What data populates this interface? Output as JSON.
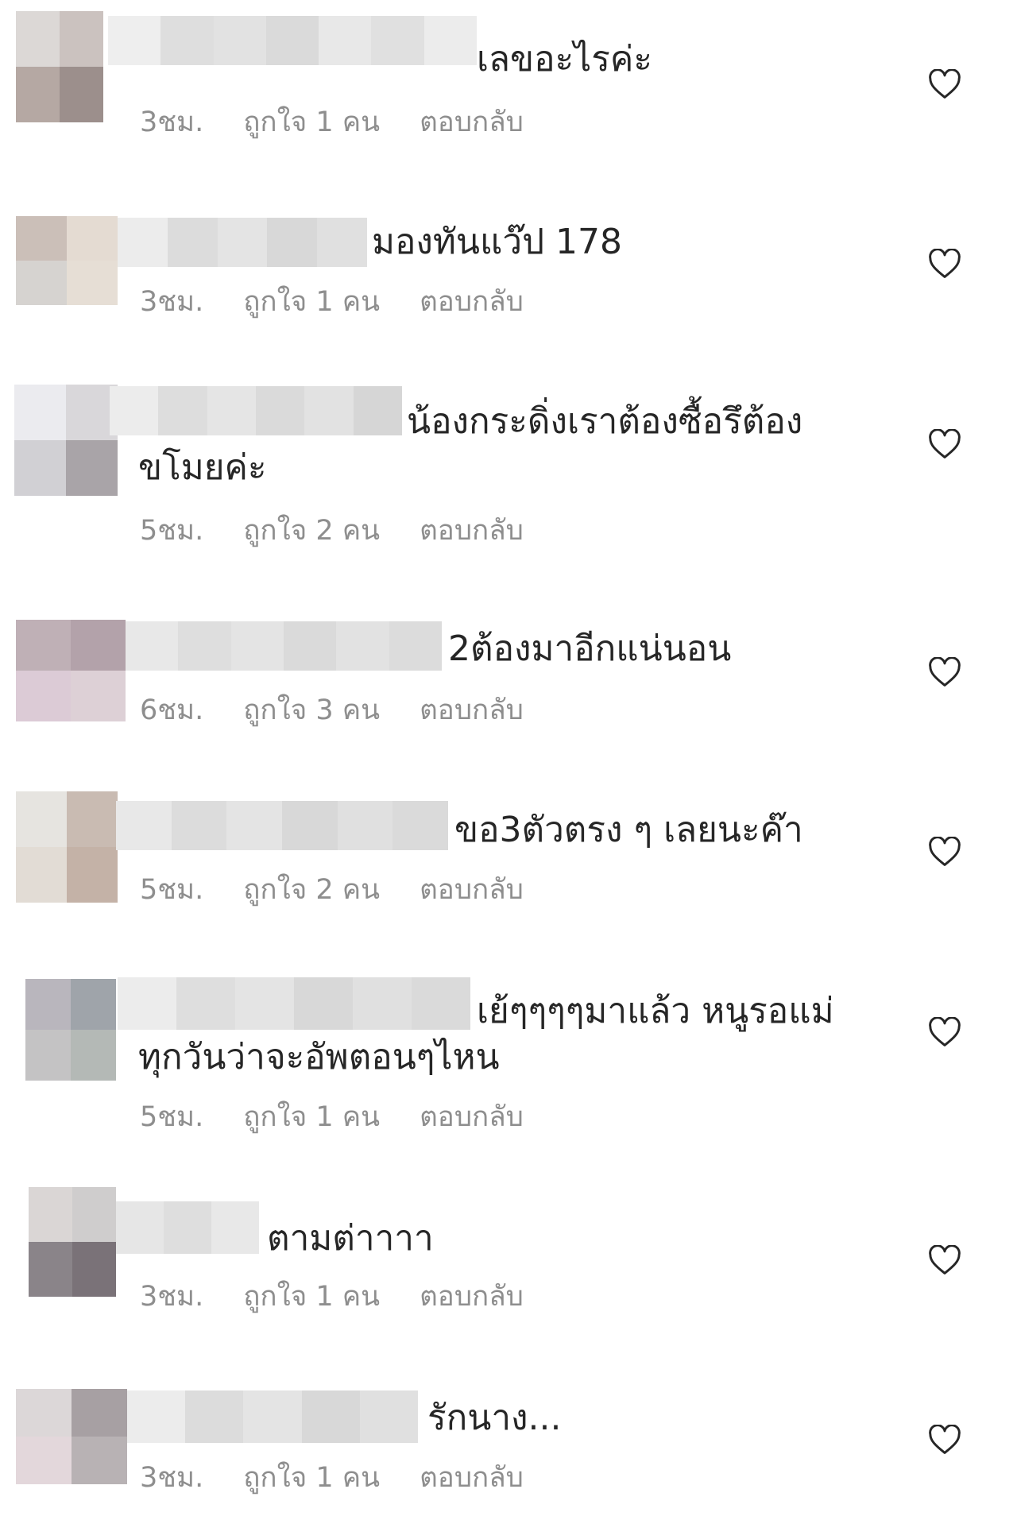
{
  "comments": [
    {
      "text_line1": "เลขอะไรค่ะ",
      "text_line2": "",
      "time": "3ชม.",
      "likes": "ถูกใจ 1 คน",
      "reply": "ตอบกลับ",
      "avatar": [
        "#dcd8d6",
        "#cbc2bf",
        "#b5a8a3",
        "#9c8f8c"
      ],
      "blur": [
        "#eeeeee",
        "#dedede",
        "#e2e2e2",
        "#dadada",
        "#e8e8e8",
        "#e0e0e0",
        "#ececec"
      ]
    },
    {
      "text_line1": "มองทันแว๊ป  178",
      "text_line2": "",
      "time": "3ชม.",
      "likes": "ถูกใจ 1 คน",
      "reply": "ตอบกลับ",
      "avatar": [
        "#cbbfb8",
        "#e4dbd2",
        "#d6d3d0",
        "#e6ded5"
      ],
      "blur": [
        "#ececec",
        "#dcdcdc",
        "#e4e4e4",
        "#d8d8d8",
        "#e0e0e0"
      ]
    },
    {
      "text_line1": "น้องกระดิ่งเราต้องซื้อรึต้อง",
      "text_line2": "ขโมยค่ะ",
      "time": "5ชม.",
      "likes": "ถูกใจ 2 คน",
      "reply": "ตอบกลับ",
      "avatar": [
        "#ebebef",
        "#d9d7da",
        "#d1d0d4",
        "#a9a4a8"
      ],
      "blur": [
        "#ececec",
        "#dddddd",
        "#e5e5e5",
        "#dadada",
        "#e2e2e2",
        "#d6d6d6"
      ]
    },
    {
      "text_line1": "2ต้องมาอีกแน่นอน",
      "text_line2": "",
      "time": "6ชม.",
      "likes": "ถูกใจ 3 คน",
      "reply": "ตอบกลับ",
      "avatar": [
        "#bfb0b6",
        "#b3a2aa",
        "#dccbd6",
        "#ddd0d6"
      ],
      "blur": [
        "#e8e8e8",
        "#dedede",
        "#e4e4e4",
        "#dadada",
        "#e2e2e2",
        "#dcdcdc"
      ]
    },
    {
      "text_line1": "ขอ3ตัวตรง ๆ เลยนะค๊า",
      "text_line2": "",
      "time": "5ชม.",
      "likes": "ถูกใจ 2 คน",
      "reply": "ตอบกลับ",
      "avatar": [
        "#e6e4e0",
        "#c9bbb2",
        "#e2dcd5",
        "#c4b2a7"
      ],
      "blur": [
        "#e8e8e8",
        "#dcdcdc",
        "#e4e4e4",
        "#d8d8d8",
        "#e0e0e0",
        "#dadada"
      ]
    },
    {
      "text_line1": "เย้ๆๆๆๆมาแล้ว หนูรอแม่",
      "text_line2": "ทุกวันว่าจะอัพตอนๆไหน",
      "time": "5ชม.",
      "likes": "ถูกใจ 1 คน",
      "reply": "ตอบกลับ",
      "avatar": [
        "#b9b6bd",
        "#9fa4aa",
        "#c4c3c4",
        "#b4b9b6"
      ],
      "blur": [
        "#ececec",
        "#dedede",
        "#e4e4e4",
        "#d8d8d8",
        "#e0e0e0",
        "#dadada"
      ]
    },
    {
      "text_line1": "ตามต่าาาา",
      "text_line2": "",
      "time": "3ชม.",
      "likes": "ถูกใจ 1 คน",
      "reply": "ตอบกลับ",
      "avatar": [
        "#dad6d5",
        "#cfcdcd",
        "#8a8489",
        "#7a7278"
      ],
      "blur": [
        "#e6e6e6",
        "#dedede",
        "#e8e8e8"
      ]
    },
    {
      "text_line1": "รักนาง...",
      "text_line2": "",
      "time": "3ชม.",
      "likes": "ถูกใจ 1 คน",
      "reply": "ตอบกลับ",
      "avatar": [
        "#dcd7d8",
        "#a7a0a3",
        "#e3d7db",
        "#b8b2b4"
      ],
      "blur": [
        "#ececec",
        "#dcdcdc",
        "#e4e4e4",
        "#d8d8d8",
        "#e0e0e0"
      ]
    }
  ],
  "icons": {
    "like": "heart-outline-icon"
  }
}
